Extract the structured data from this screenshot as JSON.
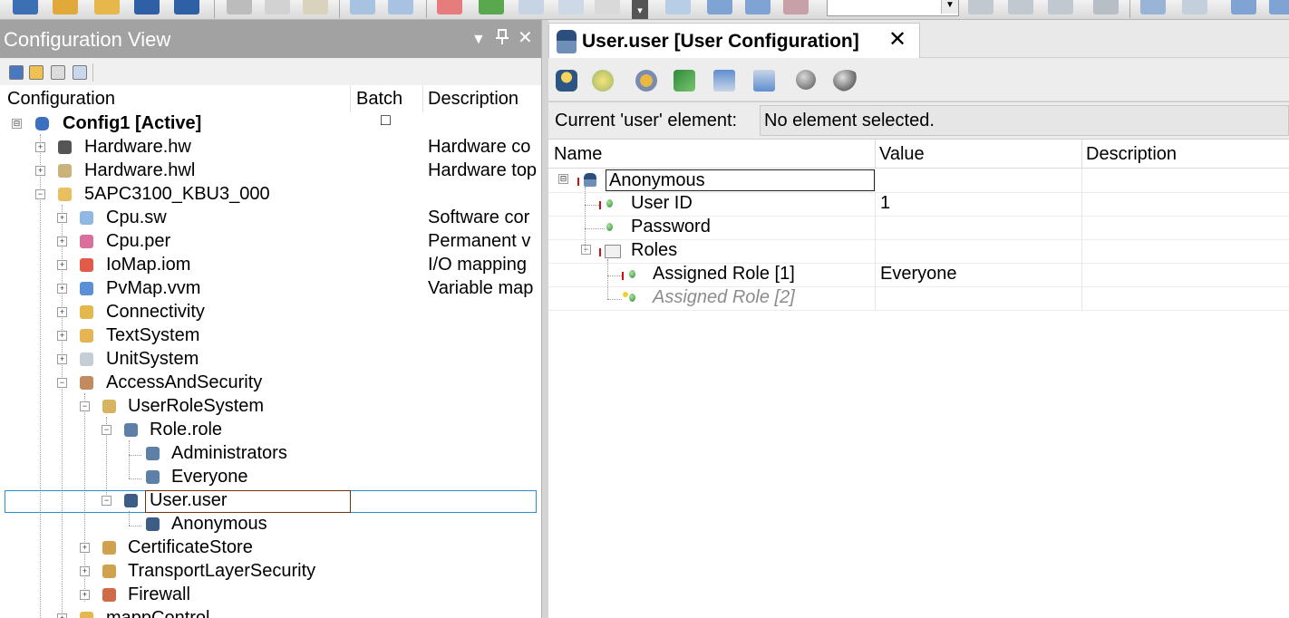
{
  "toolbar": {
    "overflow_glyph": "▾",
    "combo_value": ""
  },
  "config_view": {
    "title": "Configuration View",
    "controls": {
      "dropdown": "▼",
      "pin": "📌",
      "close": "✕"
    },
    "columns": {
      "configuration": "Configuration",
      "batch": "Batch",
      "description": "Description"
    },
    "tree": [
      {
        "label": "Config1 [Active]",
        "expander": "⊟",
        "desc": "",
        "batch": "□"
      },
      {
        "label": "Hardware.hw",
        "expander": "+",
        "desc": "Hardware co"
      },
      {
        "label": "Hardware.hwl",
        "expander": "+",
        "desc": "Hardware top"
      },
      {
        "label": "5APC3100_KBU3_000",
        "expander": "−",
        "desc": ""
      },
      {
        "label": "Cpu.sw",
        "expander": "+",
        "desc": "Software cor"
      },
      {
        "label": "Cpu.per",
        "expander": "+",
        "desc": "Permanent v"
      },
      {
        "label": "IoMap.iom",
        "expander": "+",
        "desc": "I/O mapping"
      },
      {
        "label": "PvMap.vvm",
        "expander": "+",
        "desc": "Variable map"
      },
      {
        "label": "Connectivity",
        "expander": "+",
        "desc": ""
      },
      {
        "label": "TextSystem",
        "expander": "+",
        "desc": ""
      },
      {
        "label": "UnitSystem",
        "expander": "+",
        "desc": ""
      },
      {
        "label": "AccessAndSecurity",
        "expander": "−",
        "desc": ""
      },
      {
        "label": "UserRoleSystem",
        "expander": "−",
        "desc": ""
      },
      {
        "label": "Role.role",
        "expander": "−",
        "desc": ""
      },
      {
        "label": "Administrators",
        "expander": "",
        "desc": ""
      },
      {
        "label": "Everyone",
        "expander": "",
        "desc": ""
      },
      {
        "label": "User.user",
        "expander": "−",
        "desc": ""
      },
      {
        "label": "Anonymous",
        "expander": "",
        "desc": ""
      },
      {
        "label": "CertificateStore",
        "expander": "+",
        "desc": ""
      },
      {
        "label": "TransportLayerSecurity",
        "expander": "+",
        "desc": ""
      },
      {
        "label": "Firewall",
        "expander": "+",
        "desc": ""
      },
      {
        "label": "mappControl",
        "expander": "+",
        "desc": ""
      }
    ]
  },
  "editor": {
    "tab_title": "User.user [User Configuration]",
    "tab_close": "✕",
    "current_label": "Current 'user' element:",
    "current_value": "No element selected.",
    "columns": {
      "name": "Name",
      "value": "Value",
      "description": "Description"
    },
    "rows": [
      {
        "name": "Anonymous",
        "value": "",
        "expander": "⊟"
      },
      {
        "name": "User ID",
        "value": "1"
      },
      {
        "name": "Password",
        "value": ""
      },
      {
        "name": "Roles",
        "value": "",
        "expander": "−"
      },
      {
        "name": "Assigned Role [1]",
        "value": "Everyone"
      },
      {
        "name": "Assigned Role [2]",
        "value": ""
      }
    ]
  },
  "colors": {
    "panel_header_bg": "#a2a2a2",
    "selection_border": "#2a8fd0",
    "edit_border": "#6b3410",
    "status_green": "#2f8d2f",
    "required_red": "#d01010"
  },
  "icons": {
    "config": "config-puzzle-icon",
    "user": "user-icon",
    "role": "role-masks-icon",
    "folder": "folder-icon"
  }
}
